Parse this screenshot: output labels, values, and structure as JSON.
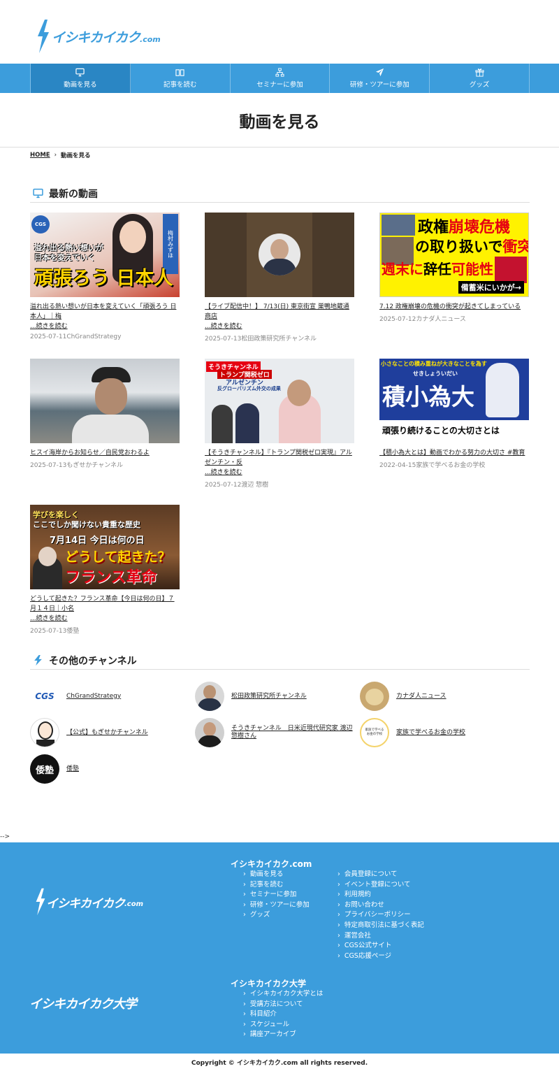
{
  "site": {
    "logo_text": "イシキカイカク",
    "logo_suffix": ".com"
  },
  "nav": [
    {
      "label": "動画を見る",
      "icon": "monitor-icon"
    },
    {
      "label": "記事を読む",
      "icon": "book-icon"
    },
    {
      "label": "セミナーに参加",
      "icon": "network-icon"
    },
    {
      "label": "研修・ツアーに参加",
      "icon": "plane-icon"
    },
    {
      "label": "グッズ",
      "icon": "gift-icon"
    }
  ],
  "page_title": "動画を見る",
  "breadcrumb": {
    "home": "HOME",
    "current": "動画を見る"
  },
  "latest": {
    "title": "最新の動画",
    "more_label": "...続きを読む",
    "cards": [
      {
        "title": "溢れ出る熱い想いが日本を変えていく「頑張ろう 日本人」｜梅",
        "more": true,
        "date": "2025-07-11",
        "channel": "ChGrandStrategy",
        "thumb": {
          "lines": [
            "溢れ出る熱い想いが",
            "日本を変えていく",
            "頑張ろう 日本人"
          ],
          "badge": "CGS",
          "side": "梅村みずほ"
        }
      },
      {
        "title": "【ライブ配信中！】 7/13(日) 東京街宣 巣鴨地蔵通商店",
        "more": true,
        "date": "2025-07-13",
        "channel": "松田政策研究所チャンネル",
        "thumb": {}
      },
      {
        "title": "7.12 政権崩壊の危機の衝突が起きてしまっている",
        "more": false,
        "date": "2025-07-12",
        "channel": "カナダ人ニュース",
        "thumb": {
          "l1a": "政権",
          "l1b": "崩壊危機",
          "l2a": "の取り扱いで",
          "l2b": "衝突",
          "l3a": "週末に",
          "l3b": "辞任",
          "l3c": "可能性",
          "l4": "備蓄米にいかが→"
        }
      },
      {
        "title": "ヒスイ海岸からお知らせ／自民党おわるよ",
        "more": false,
        "date": "2025-07-13",
        "channel": "もぎせかチャンネル",
        "thumb": {}
      },
      {
        "title": "【そうきチャンネル】『トランプ関税ゼロ実現』アルゼンチン・反",
        "more": true,
        "date": "2025-07-12",
        "channel": "渡辺 惣樹",
        "thumb": {
          "tag": "そうきチャンネル",
          "l1": "トランプ関税ゼロ",
          "l2": "アルゼンチン",
          "l3": "反グローバリズム外交の成果"
        }
      },
      {
        "title": "【積小為大とは】動画でわかる努力の大切さ #教育",
        "more": false,
        "date": "2022-04-15",
        "channel": "家族で学べるお金の学校",
        "thumb": {
          "top": "小さなことの積み重ねが大きなことを為す",
          "ruby": "せきしょういだい",
          "big": "積小為大",
          "bottom": "頑張り続けることの大切さとは"
        }
      },
      {
        "title": "どうして起きた？フランス革命【今日は何の日】７月１４日｜小名",
        "more": true,
        "date": "2025-07-13",
        "channel": "倭塾",
        "thumb": {
          "l1": "学びを楽しく",
          "l2": "ここでしか聞けない貴重な歴史",
          "l3": "7月14日 今日は何の日",
          "l4": "どうして起きた？",
          "l5": "フランス革命"
        }
      }
    ]
  },
  "other": {
    "title": "その他のチャンネル",
    "channels": [
      {
        "name": "ChGrandStrategy",
        "avatar": "CGS"
      },
      {
        "name": "松田政策研究所チャンネル",
        "avatar": ""
      },
      {
        "name": "カナダ人ニュース",
        "avatar": ""
      },
      {
        "name": "【公式】もぎせかチャンネル",
        "avatar": ""
      },
      {
        "name": "そうきチャンネル　日米近現代研究家 渡辺惣樹さん",
        "avatar": ""
      },
      {
        "name": "家族で学べるお金の学校",
        "avatar": "家族で学べる お金の学校"
      },
      {
        "name": "倭塾",
        "avatar": "倭塾"
      }
    ]
  },
  "stray_text": "-->",
  "footer": {
    "logo2": "イシキカイカク大学",
    "col1_title": "イシキカイカク.com",
    "col1": [
      "動画を見る",
      "記事を読む",
      "セミナーに参加",
      "研修・ツアーに参加",
      "グッズ"
    ],
    "col2": [
      "会員登録について",
      "イベント登録について",
      "利用規約",
      "お問い合わせ",
      "プライバシーポリシー",
      "特定商取引法に基づく表記",
      "運営会社",
      "CGS公式サイト",
      "CGS応援ページ"
    ],
    "col3_title": "イシキカイカク大学",
    "col3": [
      "イシキカイカク大学とは",
      "受講方法について",
      "科目紹介",
      "スケジュール",
      "講座アーカイブ"
    ]
  },
  "copyright": "Copyright © イシキカイカク.com all rights reserved.",
  "colors": {
    "brand": "#3c9ddc",
    "nav_active": "#2a86c4"
  }
}
